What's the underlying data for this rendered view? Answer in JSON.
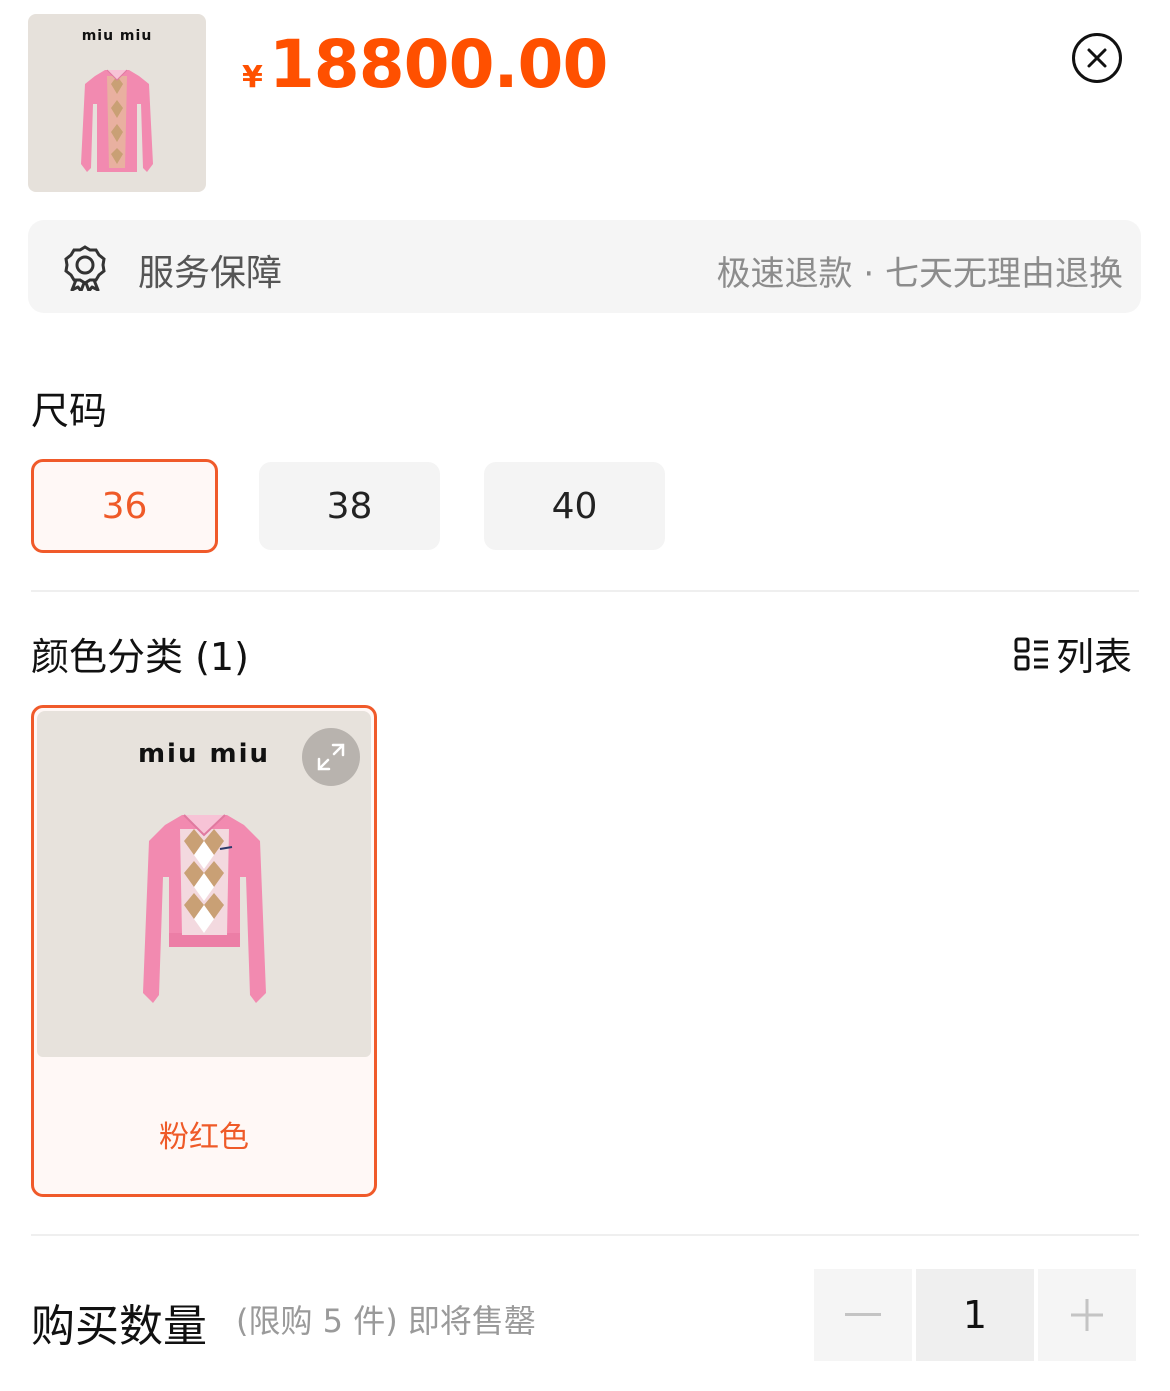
{
  "header": {
    "thumbnail_brand": "miu miu",
    "currency": "¥",
    "price": "18800.00"
  },
  "service": {
    "label": "服务保障",
    "detail": "极速退款 · 七天无理由退换"
  },
  "size": {
    "title": "尺码",
    "options": [
      "36",
      "38",
      "40"
    ],
    "selected": "36"
  },
  "color": {
    "title": "颜色分类 (1)",
    "view_toggle": "列表",
    "options": [
      {
        "brand": "miu miu",
        "label": "粉红色"
      }
    ]
  },
  "quantity": {
    "title": "购买数量",
    "note": "(限购 5 件) 即将售罄",
    "value": "1"
  },
  "colors": {
    "accent": "#ff5000",
    "selected_border": "#f05a2a",
    "sweater_pink": "#f28ab0"
  }
}
